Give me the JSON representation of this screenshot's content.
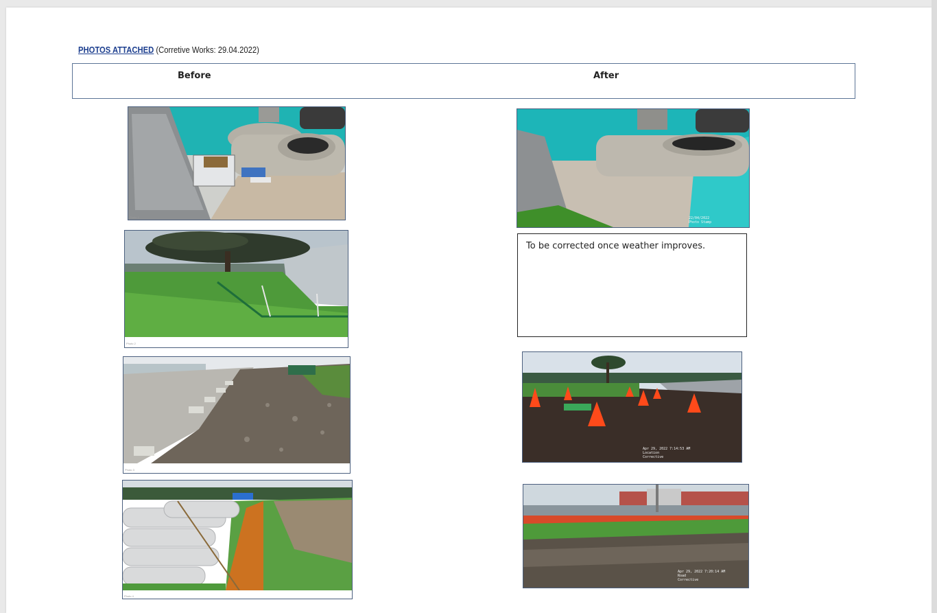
{
  "heading": {
    "link_text": "PHOTOS ATTACHED",
    "rest_text": "(Corretive Works: 29.04.2022)"
  },
  "table_header": {
    "before_label": "Before",
    "after_label": "After"
  },
  "after_note": "To be corrected once weather improves.",
  "photos": {
    "before": [
      {
        "subject": "portable toilet interior with debris"
      },
      {
        "subject": "tree by river with damaged fence on grass"
      },
      {
        "subject": "road kerb with broken ground"
      },
      {
        "subject": "concrete pipes beside orange safety net"
      }
    ],
    "after": [
      {
        "subject": "cleaned portable toilet interior"
      },
      {
        "subject": "ground with orange safety cones"
      },
      {
        "subject": "levelled ground with orange barrier"
      }
    ]
  }
}
